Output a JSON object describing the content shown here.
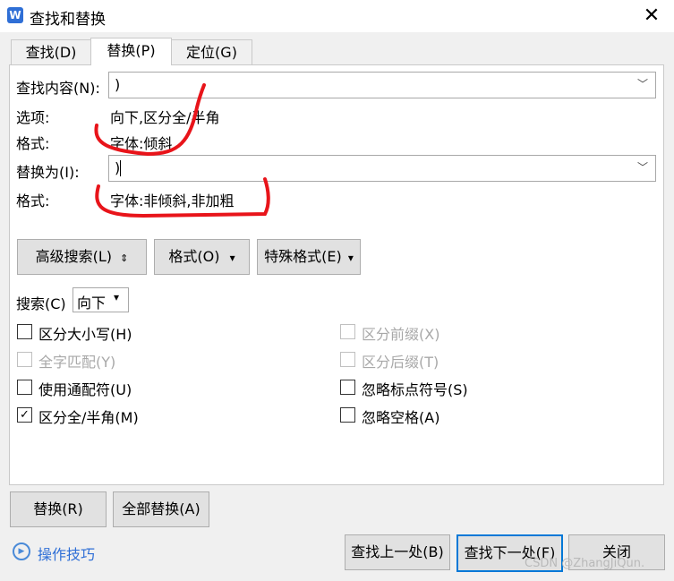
{
  "window": {
    "title": "查找和替换",
    "app_icon_glyph": "W",
    "close_glyph": "✕"
  },
  "tabs": [
    {
      "label": "查找(D)",
      "active": false
    },
    {
      "label": "替换(P)",
      "active": true
    },
    {
      "label": "定位(G)",
      "active": false
    }
  ],
  "find": {
    "label": "查找内容(N):",
    "value": ")"
  },
  "options": {
    "label": "选项:",
    "value": "向下,区分全/半角"
  },
  "find_format": {
    "label": "格式:",
    "value": "字体:倾斜"
  },
  "replace": {
    "label": "替换为(I):",
    "value": ")"
  },
  "replace_format": {
    "label": "格式:",
    "value": "字体:非倾斜,非加粗"
  },
  "option_buttons": {
    "advanced": "高级搜索(L)",
    "advanced_arrow": "⇕",
    "format": "格式(O)",
    "special": "特殊格式(E)",
    "dropdown_arrow": "▾"
  },
  "search": {
    "label": "搜索(C)",
    "direction": "向下"
  },
  "checkboxes_left": [
    {
      "label": "区分大小写(H)",
      "checked": false,
      "disabled": false
    },
    {
      "label": "全字匹配(Y)",
      "checked": false,
      "disabled": true
    },
    {
      "label": "使用通配符(U)",
      "checked": false,
      "disabled": false
    },
    {
      "label": "区分全/半角(M)",
      "checked": true,
      "disabled": false
    }
  ],
  "checkboxes_right": [
    {
      "label": "区分前缀(X)",
      "checked": false,
      "disabled": true
    },
    {
      "label": "区分后缀(T)",
      "checked": false,
      "disabled": true
    },
    {
      "label": "忽略标点符号(S)",
      "checked": false,
      "disabled": false
    },
    {
      "label": "忽略空格(A)",
      "checked": false,
      "disabled": false
    }
  ],
  "check_glyph": "✓",
  "buttons": {
    "replace": "替换(R)",
    "replace_all": "全部替换(A)",
    "find_prev": "查找上一处(B)",
    "find_next": "查找下一处(F)",
    "close": "关闭"
  },
  "help": {
    "label": "操作技巧",
    "icon": "play-icon"
  },
  "watermark": "CSDN @ZhangJiQun.",
  "colors": {
    "accent": "#0078d7",
    "annotation": "#e8141a",
    "link": "#2f6fd6"
  }
}
